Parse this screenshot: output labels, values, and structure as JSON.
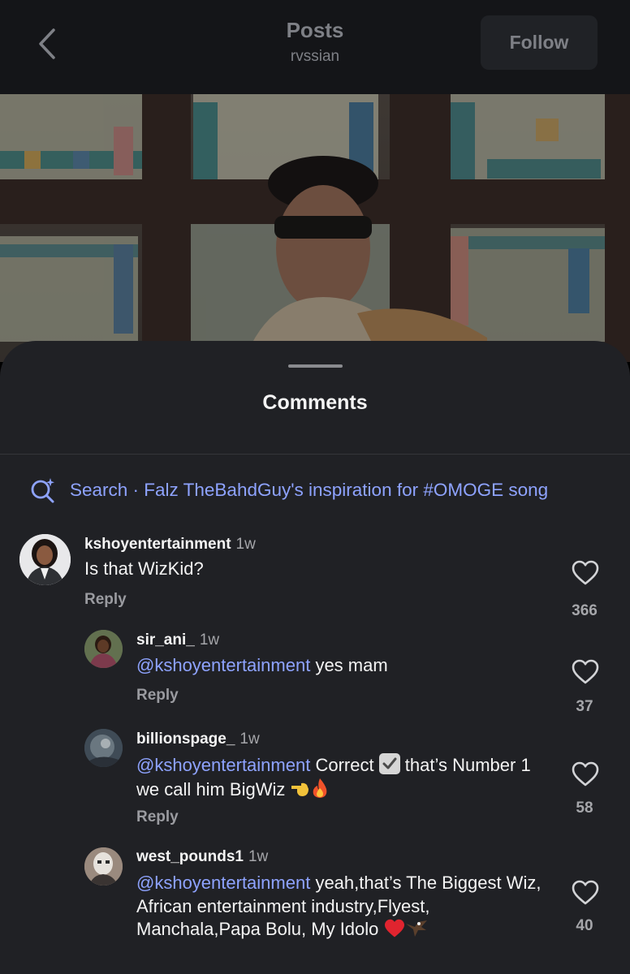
{
  "header": {
    "title": "Posts",
    "subtitle": "rvssian",
    "follow_label": "Follow"
  },
  "comments_sheet": {
    "title": "Comments",
    "search": {
      "prefix": "Search · ",
      "query": "Falz TheBahdGuy's inspiration for #OMOGE song"
    }
  },
  "comments": [
    {
      "username": "kshoyentertainment",
      "time": "1w",
      "text": "Is that WizKid?",
      "reply_label": "Reply",
      "likes": "366"
    },
    {
      "username": "sir_ani_",
      "time": "1w",
      "mention": "@kshoyentertainment",
      "text": " yes mam",
      "reply_label": "Reply",
      "likes": "37"
    },
    {
      "username": "billionspage_",
      "time": "1w",
      "mention": "@kshoyentertainment",
      "text_part1": " Correct ",
      "text_part2": " that’s Number 1 we call him BigWiz ",
      "reply_label": "Reply",
      "likes": "58"
    },
    {
      "username": "west_pounds1",
      "time": "1w",
      "mention": "@kshoyentertainment",
      "text": " yeah,that’s The Biggest Wiz, African entertainment industry,Flyest, Manchala,Papa Bolu, My Idolo ",
      "likes": "40"
    }
  ],
  "colors": {
    "accent_link": "#8ea3ff",
    "sheet_bg": "#202125",
    "header_bg": "#141518"
  },
  "icons": [
    "back-chevron-icon",
    "search-sparkle-icon",
    "heart-icon",
    "checkmark-emoji-icon",
    "pointing-hand-emoji-icon",
    "fire-emoji-icon",
    "red-heart-emoji-icon",
    "eagle-emoji-icon"
  ]
}
